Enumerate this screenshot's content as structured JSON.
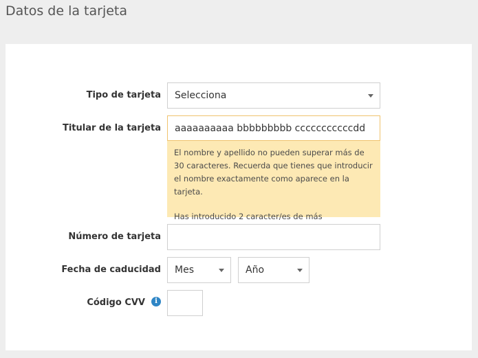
{
  "section": {
    "title": "Datos de la tarjeta"
  },
  "form": {
    "card_type": {
      "label": "Tipo de tarjeta",
      "selected": "Selecciona"
    },
    "holder": {
      "label": "Titular de la tarjeta",
      "value": "aaaaaaaaaa bbbbbbbbb cccccccccccdd",
      "notice": {
        "message": "El nombre y apellido no pueden superar más de 30 caracteres. Recuerda que tienes que introducir el nombre exactamente como aparece en la tarjeta.",
        "error": "Has introducido 2 caracter/es de más"
      }
    },
    "card_number": {
      "label": "Número de tarjeta",
      "value": ""
    },
    "expiry": {
      "label": "Fecha de caducidad",
      "month_selected": "Mes",
      "year_selected": "Año"
    },
    "cvv": {
      "label": "Código CVV",
      "info_icon": "info-icon",
      "value": ""
    }
  },
  "colors": {
    "background": "#eeeeee",
    "panel": "#ffffff",
    "notice_bg": "#fde9b4",
    "notice_border": "#f0c36d",
    "info_icon": "#2f86c6"
  }
}
